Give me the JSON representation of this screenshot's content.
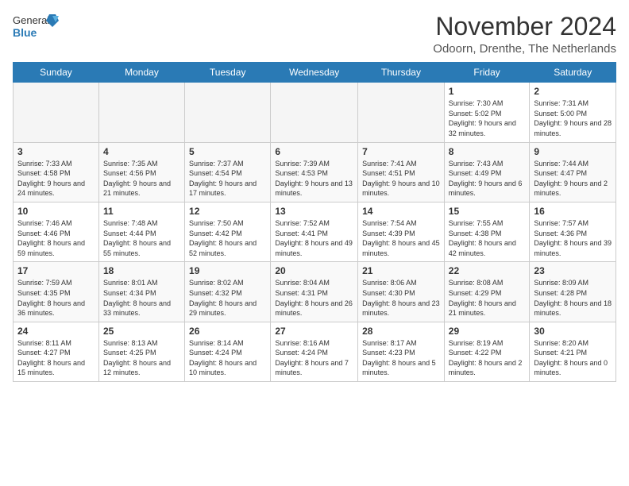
{
  "header": {
    "logo_general": "General",
    "logo_blue": "Blue",
    "title": "November 2024",
    "subtitle": "Odoorn, Drenthe, The Netherlands"
  },
  "weekdays": [
    "Sunday",
    "Monday",
    "Tuesday",
    "Wednesday",
    "Thursday",
    "Friday",
    "Saturday"
  ],
  "weeks": [
    [
      {
        "day": "",
        "info": ""
      },
      {
        "day": "",
        "info": ""
      },
      {
        "day": "",
        "info": ""
      },
      {
        "day": "",
        "info": ""
      },
      {
        "day": "",
        "info": ""
      },
      {
        "day": "1",
        "info": "Sunrise: 7:30 AM\nSunset: 5:02 PM\nDaylight: 9 hours and 32 minutes."
      },
      {
        "day": "2",
        "info": "Sunrise: 7:31 AM\nSunset: 5:00 PM\nDaylight: 9 hours and 28 minutes."
      }
    ],
    [
      {
        "day": "3",
        "info": "Sunrise: 7:33 AM\nSunset: 4:58 PM\nDaylight: 9 hours and 24 minutes."
      },
      {
        "day": "4",
        "info": "Sunrise: 7:35 AM\nSunset: 4:56 PM\nDaylight: 9 hours and 21 minutes."
      },
      {
        "day": "5",
        "info": "Sunrise: 7:37 AM\nSunset: 4:54 PM\nDaylight: 9 hours and 17 minutes."
      },
      {
        "day": "6",
        "info": "Sunrise: 7:39 AM\nSunset: 4:53 PM\nDaylight: 9 hours and 13 minutes."
      },
      {
        "day": "7",
        "info": "Sunrise: 7:41 AM\nSunset: 4:51 PM\nDaylight: 9 hours and 10 minutes."
      },
      {
        "day": "8",
        "info": "Sunrise: 7:43 AM\nSunset: 4:49 PM\nDaylight: 9 hours and 6 minutes."
      },
      {
        "day": "9",
        "info": "Sunrise: 7:44 AM\nSunset: 4:47 PM\nDaylight: 9 hours and 2 minutes."
      }
    ],
    [
      {
        "day": "10",
        "info": "Sunrise: 7:46 AM\nSunset: 4:46 PM\nDaylight: 8 hours and 59 minutes."
      },
      {
        "day": "11",
        "info": "Sunrise: 7:48 AM\nSunset: 4:44 PM\nDaylight: 8 hours and 55 minutes."
      },
      {
        "day": "12",
        "info": "Sunrise: 7:50 AM\nSunset: 4:42 PM\nDaylight: 8 hours and 52 minutes."
      },
      {
        "day": "13",
        "info": "Sunrise: 7:52 AM\nSunset: 4:41 PM\nDaylight: 8 hours and 49 minutes."
      },
      {
        "day": "14",
        "info": "Sunrise: 7:54 AM\nSunset: 4:39 PM\nDaylight: 8 hours and 45 minutes."
      },
      {
        "day": "15",
        "info": "Sunrise: 7:55 AM\nSunset: 4:38 PM\nDaylight: 8 hours and 42 minutes."
      },
      {
        "day": "16",
        "info": "Sunrise: 7:57 AM\nSunset: 4:36 PM\nDaylight: 8 hours and 39 minutes."
      }
    ],
    [
      {
        "day": "17",
        "info": "Sunrise: 7:59 AM\nSunset: 4:35 PM\nDaylight: 8 hours and 36 minutes."
      },
      {
        "day": "18",
        "info": "Sunrise: 8:01 AM\nSunset: 4:34 PM\nDaylight: 8 hours and 33 minutes."
      },
      {
        "day": "19",
        "info": "Sunrise: 8:02 AM\nSunset: 4:32 PM\nDaylight: 8 hours and 29 minutes."
      },
      {
        "day": "20",
        "info": "Sunrise: 8:04 AM\nSunset: 4:31 PM\nDaylight: 8 hours and 26 minutes."
      },
      {
        "day": "21",
        "info": "Sunrise: 8:06 AM\nSunset: 4:30 PM\nDaylight: 8 hours and 23 minutes."
      },
      {
        "day": "22",
        "info": "Sunrise: 8:08 AM\nSunset: 4:29 PM\nDaylight: 8 hours and 21 minutes."
      },
      {
        "day": "23",
        "info": "Sunrise: 8:09 AM\nSunset: 4:28 PM\nDaylight: 8 hours and 18 minutes."
      }
    ],
    [
      {
        "day": "24",
        "info": "Sunrise: 8:11 AM\nSunset: 4:27 PM\nDaylight: 8 hours and 15 minutes."
      },
      {
        "day": "25",
        "info": "Sunrise: 8:13 AM\nSunset: 4:25 PM\nDaylight: 8 hours and 12 minutes."
      },
      {
        "day": "26",
        "info": "Sunrise: 8:14 AM\nSunset: 4:24 PM\nDaylight: 8 hours and 10 minutes."
      },
      {
        "day": "27",
        "info": "Sunrise: 8:16 AM\nSunset: 4:24 PM\nDaylight: 8 hours and 7 minutes."
      },
      {
        "day": "28",
        "info": "Sunrise: 8:17 AM\nSunset: 4:23 PM\nDaylight: 8 hours and 5 minutes."
      },
      {
        "day": "29",
        "info": "Sunrise: 8:19 AM\nSunset: 4:22 PM\nDaylight: 8 hours and 2 minutes."
      },
      {
        "day": "30",
        "info": "Sunrise: 8:20 AM\nSunset: 4:21 PM\nDaylight: 8 hours and 0 minutes."
      }
    ]
  ]
}
